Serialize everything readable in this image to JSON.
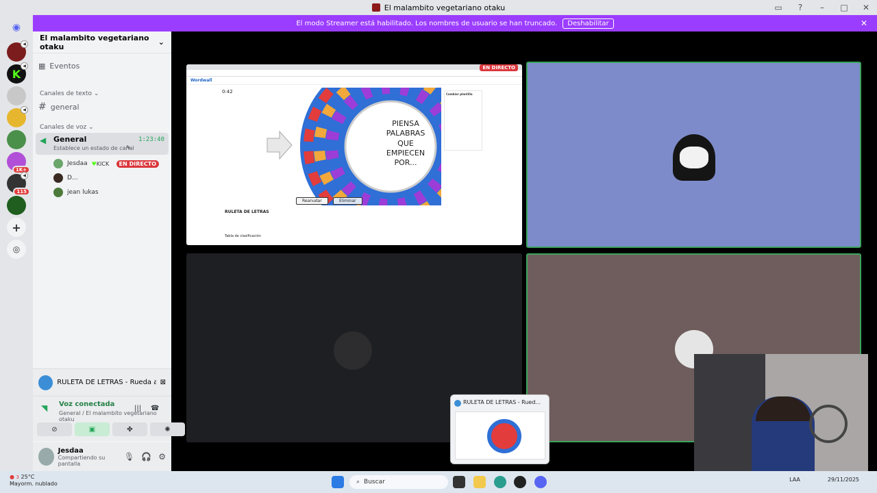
{
  "window": {
    "title": "El malambito vegetariano otaku"
  },
  "banner": {
    "text": "El modo Streamer está habilitado. Los nombres de usuario se han truncado.",
    "button": "Deshabilitar"
  },
  "rail": {
    "badges": [
      "1K+",
      "115"
    ]
  },
  "sidebar": {
    "server_name": "El malambito vegetariano otaku",
    "events_label": "Eventos",
    "text_category": "Canales de texto",
    "text_channel": "general",
    "voice_category": "Canales de voz",
    "voice_channel": {
      "name": "General",
      "timer": "1:23:40",
      "status_hint": "Establece un estado de canal"
    },
    "voice_users": [
      {
        "name": "Jesdaa",
        "tag": "KICK",
        "live": "EN DIRECTO"
      },
      {
        "name": "D..."
      },
      {
        "name": "jean lukas"
      }
    ],
    "activity": {
      "title": "RULETA DE LETRAS - Rueda aleato..."
    },
    "voice_connection": {
      "status": "Voz conectada",
      "location": "General / El malambito vegetariano otaku"
    },
    "user": {
      "name": "Jesdaa",
      "status": "Compartiendo su pantalla"
    }
  },
  "stream": {
    "live_tag": "EN DIRECTO",
    "wordwall_logo": "Wordwall",
    "timer": "0:42",
    "wheel_center": [
      "PIENSA",
      "PALABRAS",
      "QUE",
      "EMPIECEN",
      "POR..."
    ],
    "panel_title": "Cambiar plantilla",
    "restart_button": "Reanudar",
    "delete_button": "Eliminar",
    "activity_title": "RULETA DE LETRAS",
    "leaderboard_title": "Tabla de clasificación"
  },
  "preview": {
    "title": "RULETA DE LETRAS - Rued..."
  },
  "taskbar": {
    "weather_temp": "25°C",
    "weather_desc": "Mayorm. nublado",
    "weather_badge": "3",
    "search_placeholder": "Buscar",
    "lang": "LAA",
    "date": "29/11/2025"
  }
}
